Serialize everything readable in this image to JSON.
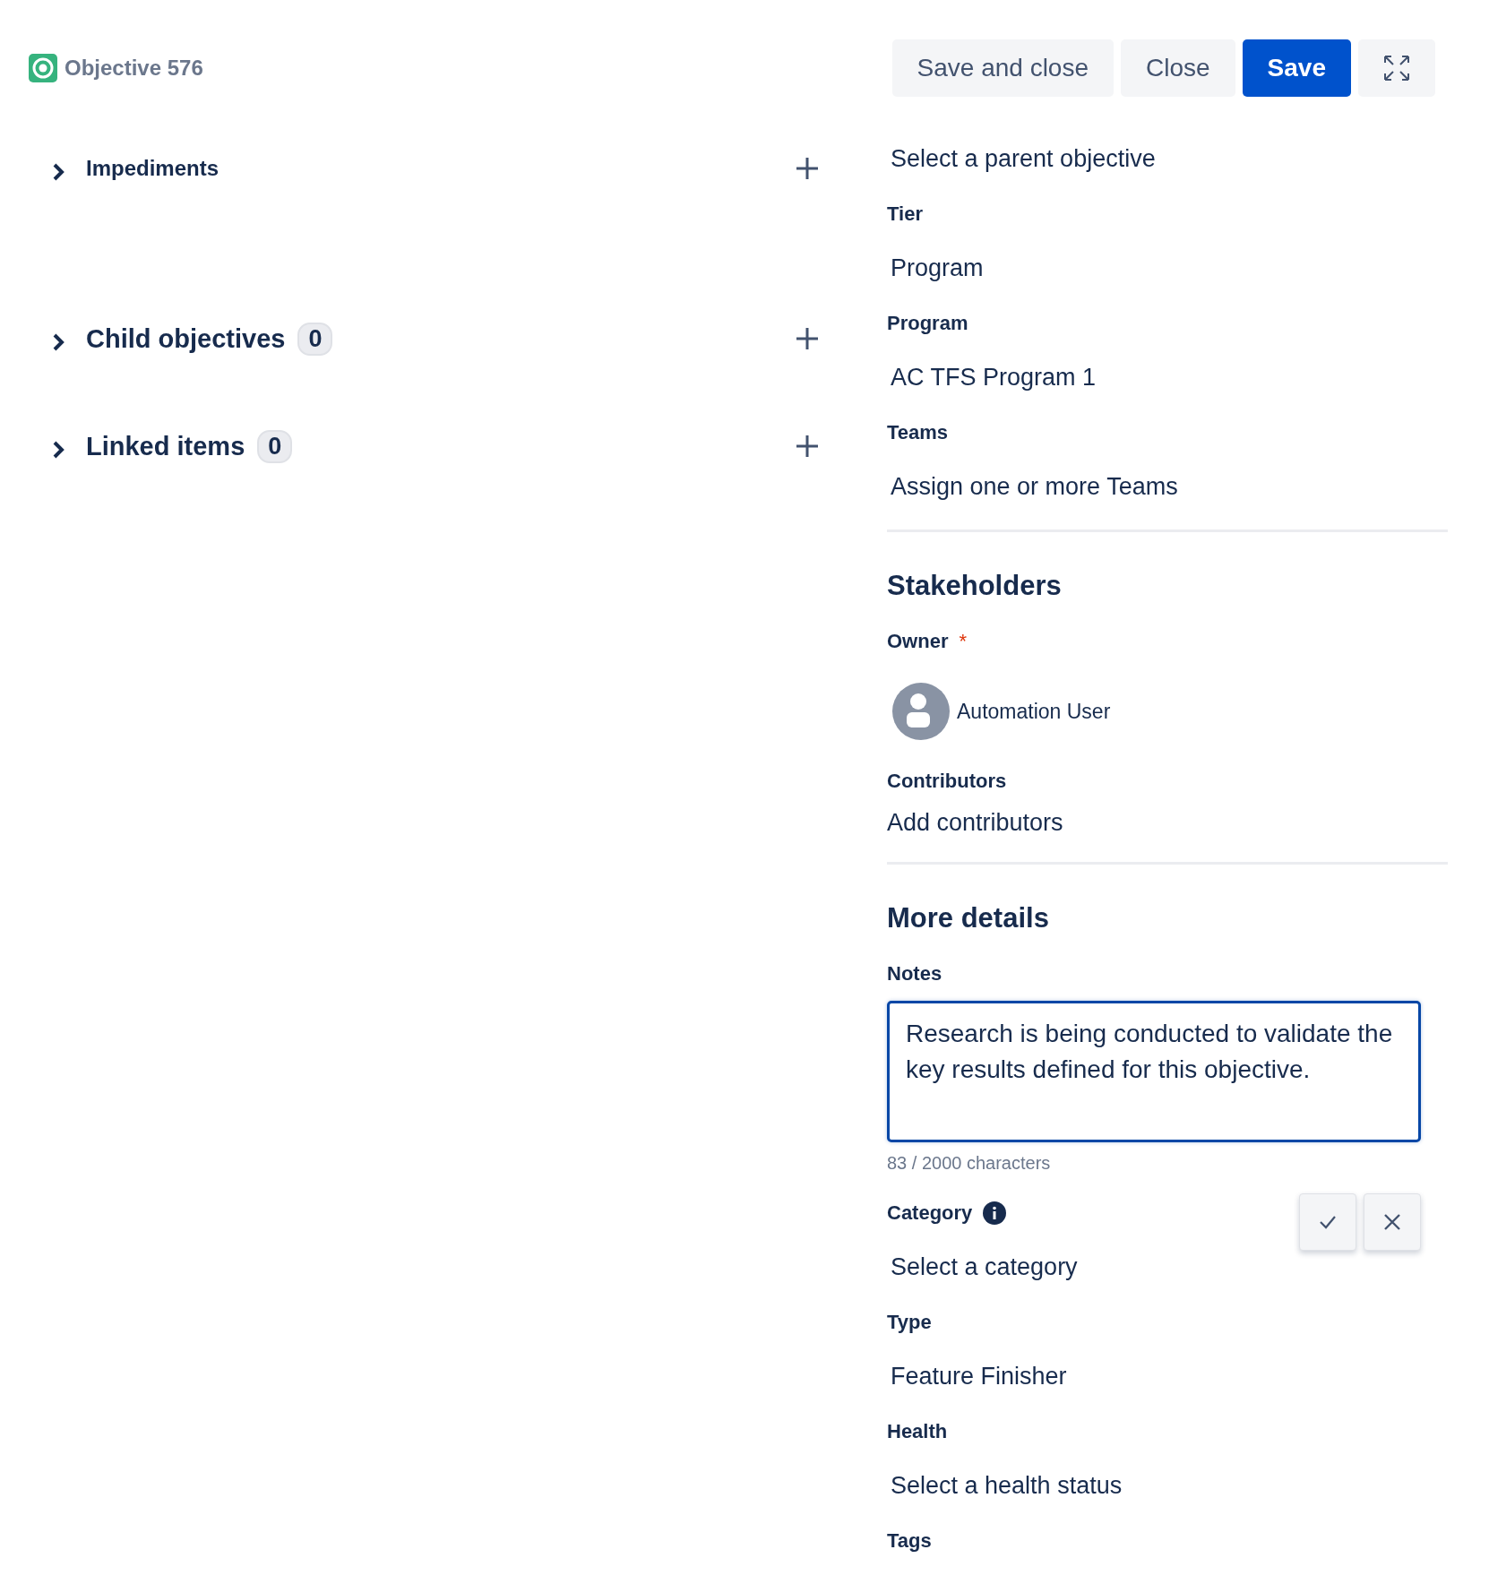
{
  "header": {
    "title": "Objective 576"
  },
  "actions": [
    {
      "kind": "secondary",
      "label": "Save and close"
    },
    {
      "kind": "secondary",
      "label": "Close"
    },
    {
      "kind": "primary",
      "label": "Save"
    },
    {
      "kind": "expand"
    }
  ],
  "left_sections": [
    {
      "title": "Impediments",
      "expanded": false
    },
    {
      "title": "Child objectives",
      "count": "0",
      "expanded": false
    },
    {
      "title": "Linked items",
      "count": "0",
      "expanded": false
    }
  ],
  "details": [
    {
      "kind": "value",
      "value": "Select a parent objective"
    },
    {
      "kind": "field",
      "label": "Tier",
      "value": "Program"
    },
    {
      "kind": "field",
      "label": "Program",
      "value": "AC TFS Program 1"
    },
    {
      "kind": "field",
      "label": "Teams",
      "value": "Assign one or more Teams"
    },
    {
      "kind": "divider"
    },
    {
      "kind": "heading",
      "text": "Stakeholders"
    },
    {
      "kind": "person",
      "label": "Owner",
      "required_mark": "*",
      "value": "Automation User"
    },
    {
      "kind": "plain",
      "label": "Contributors",
      "value": "Add contributors"
    },
    {
      "kind": "divider"
    },
    {
      "kind": "heading",
      "text": "More details"
    },
    {
      "kind": "textarea",
      "label": "Notes",
      "value": "Research is being conducted to validate the key results defined for this objective.",
      "counter": "83 / 2000 characters",
      "focused": true
    },
    {
      "kind": "field",
      "label": "Category",
      "info": true,
      "value": "Select a category"
    },
    {
      "kind": "field",
      "label": "Type",
      "value": "Feature Finisher"
    },
    {
      "kind": "field",
      "label": "Health",
      "value": "Select a health status"
    },
    {
      "kind": "label",
      "label": "Tags"
    }
  ]
}
